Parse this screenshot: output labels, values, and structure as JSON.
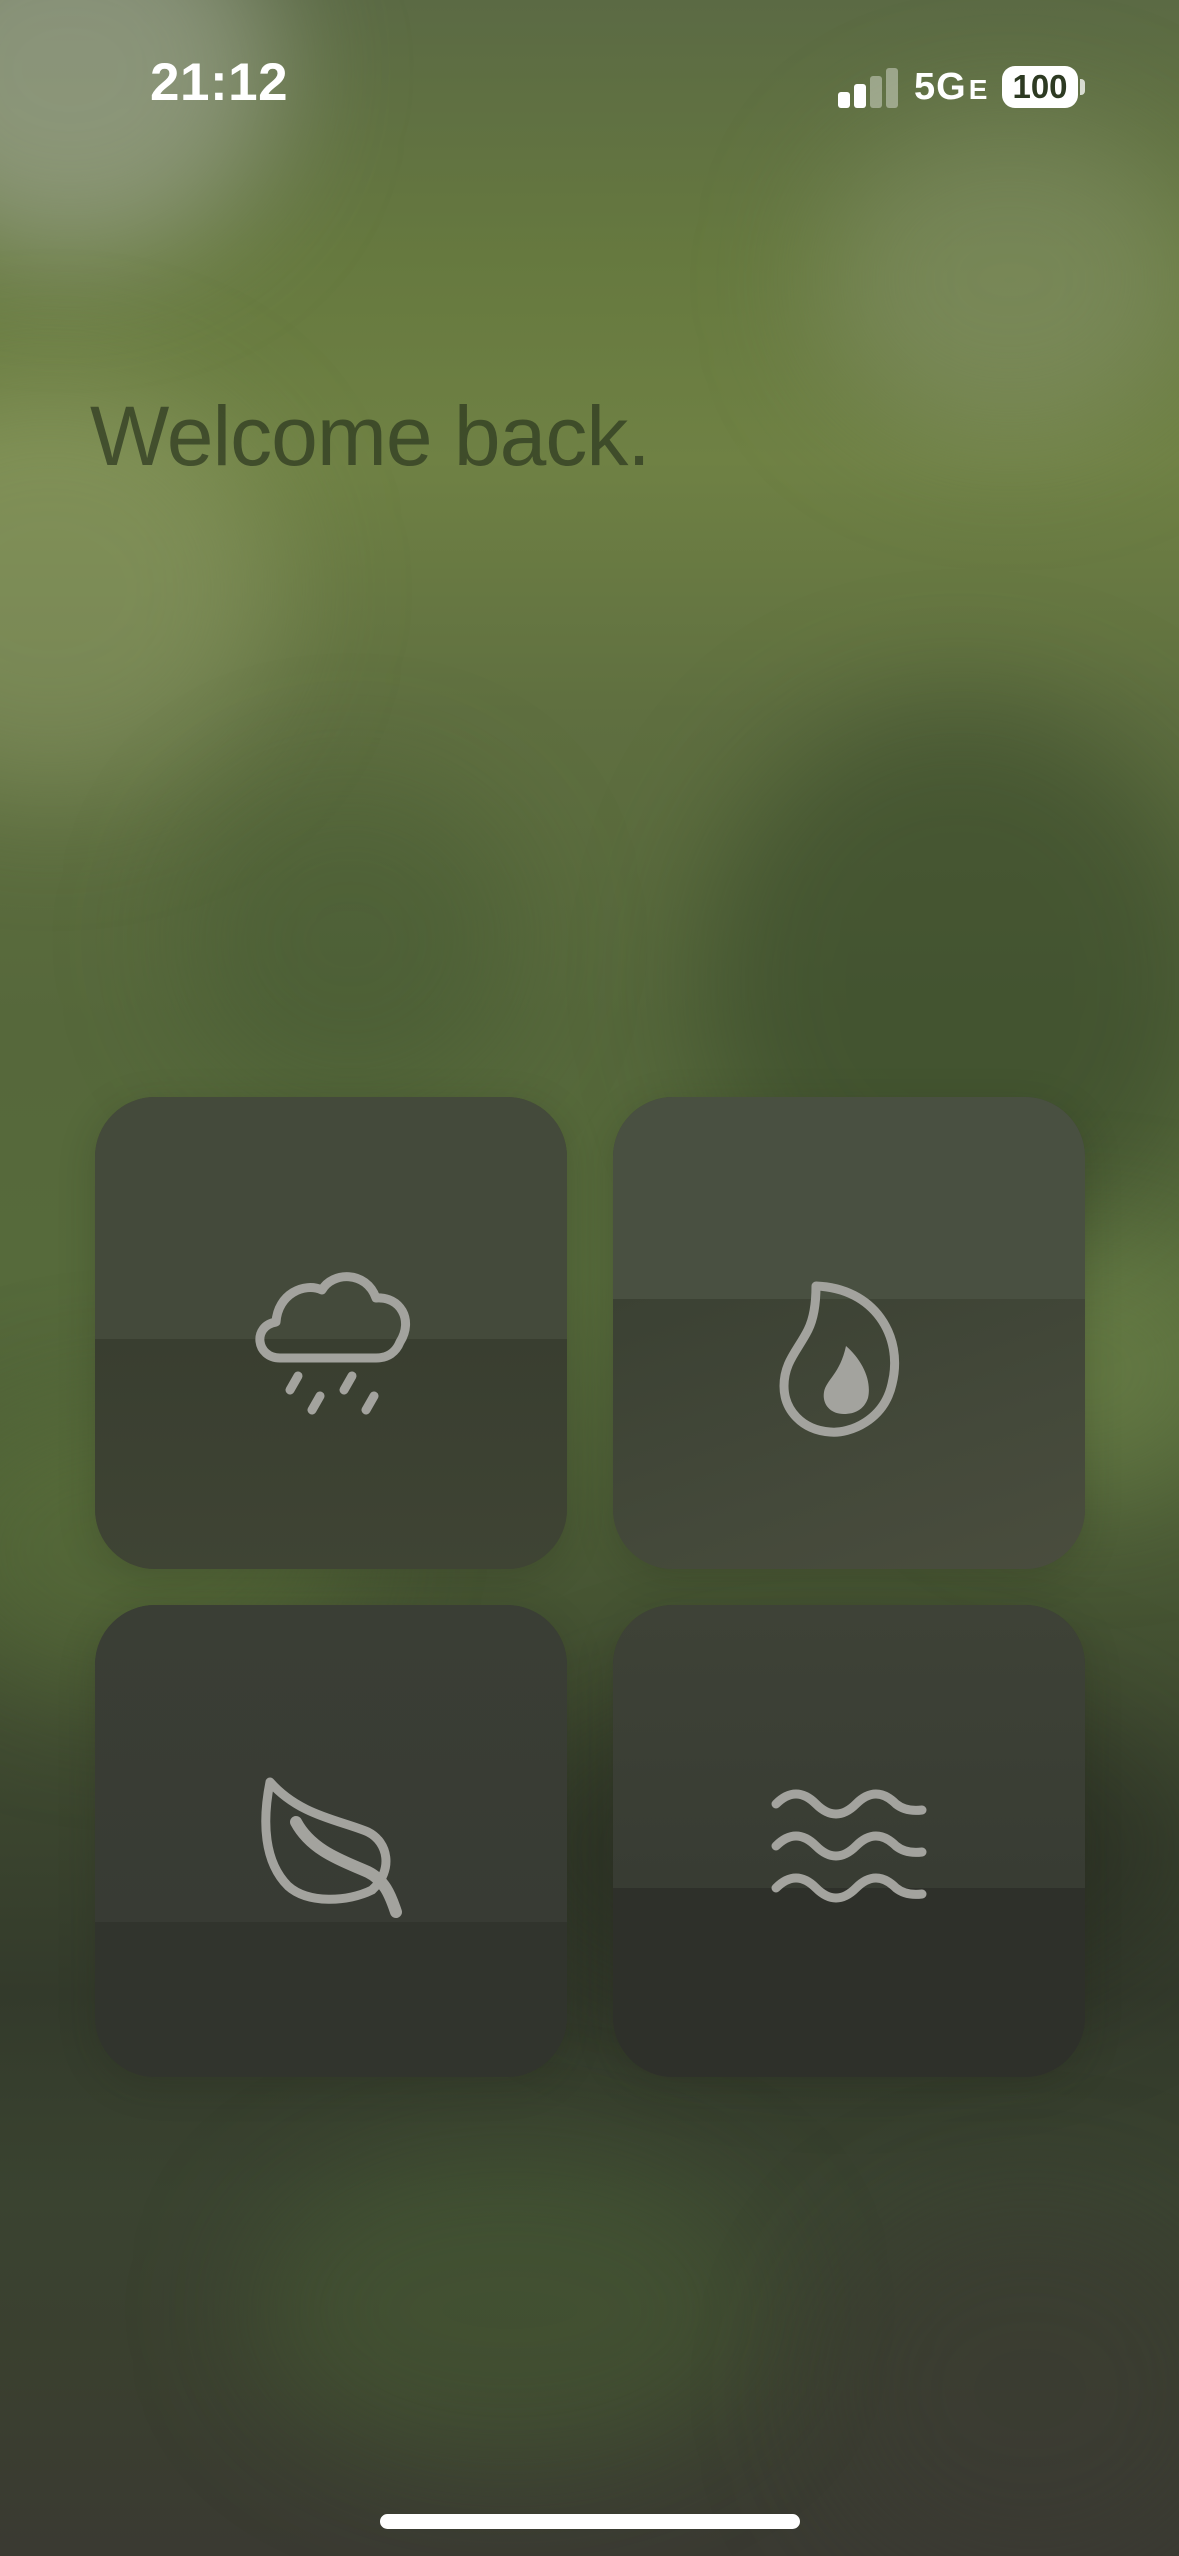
{
  "status_bar": {
    "time": "21:12",
    "network_label": "5G",
    "network_suffix": "E",
    "battery_level": "100",
    "signal_bars_active": 2,
    "signal_bars_total": 4
  },
  "greeting": "Welcome back.",
  "tiles": [
    {
      "icon": "cloud-rain-icon"
    },
    {
      "icon": "flame-icon"
    },
    {
      "icon": "leaf-icon"
    },
    {
      "icon": "water-waves-icon"
    }
  ],
  "colors": {
    "icon_stroke": "#a3a39e",
    "text_primary": "#ffffff"
  }
}
